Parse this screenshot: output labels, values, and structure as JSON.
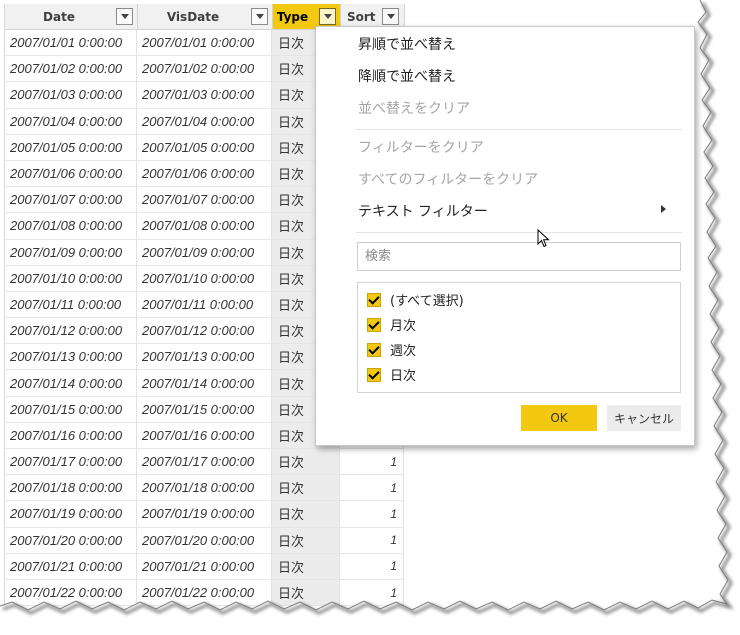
{
  "grid": {
    "columns": [
      {
        "label": "Date"
      },
      {
        "label": "VisDate"
      },
      {
        "label": "Type"
      },
      {
        "label": "Sort"
      }
    ],
    "rows": [
      {
        "date": "2007/01/01 0:00:00",
        "visdate": "2007/01/01 0:00:00",
        "type": "日次",
        "sort": ""
      },
      {
        "date": "2007/01/02 0:00:00",
        "visdate": "2007/01/02 0:00:00",
        "type": "日次",
        "sort": ""
      },
      {
        "date": "2007/01/03 0:00:00",
        "visdate": "2007/01/03 0:00:00",
        "type": "日次",
        "sort": ""
      },
      {
        "date": "2007/01/04 0:00:00",
        "visdate": "2007/01/04 0:00:00",
        "type": "日次",
        "sort": ""
      },
      {
        "date": "2007/01/05 0:00:00",
        "visdate": "2007/01/05 0:00:00",
        "type": "日次",
        "sort": ""
      },
      {
        "date": "2007/01/06 0:00:00",
        "visdate": "2007/01/06 0:00:00",
        "type": "日次",
        "sort": ""
      },
      {
        "date": "2007/01/07 0:00:00",
        "visdate": "2007/01/07 0:00:00",
        "type": "日次",
        "sort": ""
      },
      {
        "date": "2007/01/08 0:00:00",
        "visdate": "2007/01/08 0:00:00",
        "type": "日次",
        "sort": ""
      },
      {
        "date": "2007/01/09 0:00:00",
        "visdate": "2007/01/09 0:00:00",
        "type": "日次",
        "sort": ""
      },
      {
        "date": "2007/01/10 0:00:00",
        "visdate": "2007/01/10 0:00:00",
        "type": "日次",
        "sort": ""
      },
      {
        "date": "2007/01/11 0:00:00",
        "visdate": "2007/01/11 0:00:00",
        "type": "日次",
        "sort": ""
      },
      {
        "date": "2007/01/12 0:00:00",
        "visdate": "2007/01/12 0:00:00",
        "type": "日次",
        "sort": ""
      },
      {
        "date": "2007/01/13 0:00:00",
        "visdate": "2007/01/13 0:00:00",
        "type": "日次",
        "sort": ""
      },
      {
        "date": "2007/01/14 0:00:00",
        "visdate": "2007/01/14 0:00:00",
        "type": "日次",
        "sort": ""
      },
      {
        "date": "2007/01/15 0:00:00",
        "visdate": "2007/01/15 0:00:00",
        "type": "日次",
        "sort": ""
      },
      {
        "date": "2007/01/16 0:00:00",
        "visdate": "2007/01/16 0:00:00",
        "type": "日次",
        "sort": ""
      },
      {
        "date": "2007/01/17 0:00:00",
        "visdate": "2007/01/17 0:00:00",
        "type": "日次",
        "sort": "1"
      },
      {
        "date": "2007/01/18 0:00:00",
        "visdate": "2007/01/18 0:00:00",
        "type": "日次",
        "sort": "1"
      },
      {
        "date": "2007/01/19 0:00:00",
        "visdate": "2007/01/19 0:00:00",
        "type": "日次",
        "sort": "1"
      },
      {
        "date": "2007/01/20 0:00:00",
        "visdate": "2007/01/20 0:00:00",
        "type": "日次",
        "sort": "1"
      },
      {
        "date": "2007/01/21 0:00:00",
        "visdate": "2007/01/21 0:00:00",
        "type": "日次",
        "sort": "1"
      },
      {
        "date": "2007/01/22 0:00:00",
        "visdate": "2007/01/22 0:00:00",
        "type": "日次",
        "sort": "1"
      }
    ]
  },
  "menu": {
    "sort_asc": "昇順で並べ替え",
    "sort_desc": "降順で並べ替え",
    "clear_sort": "並べ替えをクリア",
    "clear_filter": "フィルターをクリア",
    "clear_all_filters": "すべてのフィルターをクリア",
    "text_filter": "テキスト フィルター",
    "search_placeholder": "検索",
    "options": [
      {
        "label": "(すべて選択)",
        "checked": true
      },
      {
        "label": "月次",
        "checked": true
      },
      {
        "label": "週次",
        "checked": true
      },
      {
        "label": "日次",
        "checked": true
      }
    ],
    "ok_label": "OK",
    "cancel_label": "キャンセル"
  },
  "colors": {
    "accent": "#f2c811",
    "header_bg": "#f1f1f1",
    "disabled_text": "#a6a6a6"
  },
  "icons": {
    "dropdown": "chevron-down-icon",
    "submenu": "chevron-right-icon",
    "checkbox": "checkmark-icon",
    "cursor": "mouse-pointer-icon"
  }
}
